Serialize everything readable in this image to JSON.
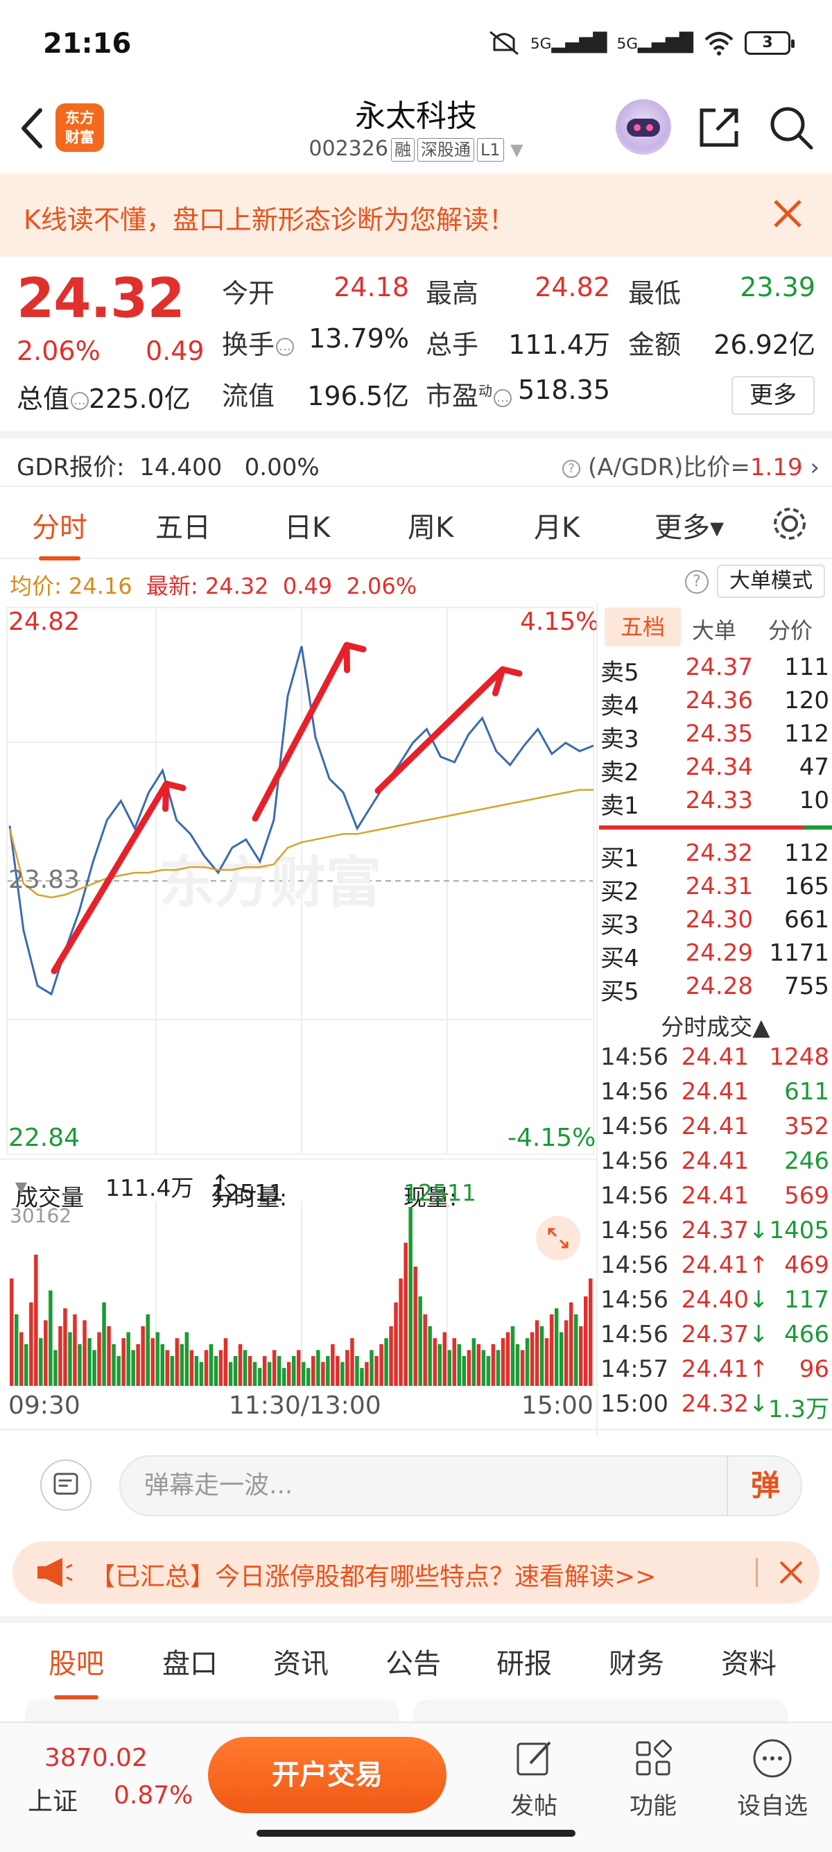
{
  "status_bar": {
    "time": "21:16",
    "net1": "5G",
    "net2": "5G",
    "battery": "3"
  },
  "nav": {
    "title": "永太科技",
    "code": "002326",
    "tags": [
      "融",
      "深股通",
      "L1"
    ],
    "logo_text_1": "东方",
    "logo_text_2": "财富"
  },
  "tip_banner": {
    "text": "K线读不懂，盘口上新形态诊断为您解读！"
  },
  "quote": {
    "price": "24.32",
    "change_pct": "2.06%",
    "change_amt": "0.49",
    "market_cap_label": "总值",
    "market_cap": "225.0亿",
    "open_label": "今开",
    "open": "24.18",
    "high_label": "最高",
    "high": "24.82",
    "low_label": "最低",
    "low": "23.39",
    "turnover_label": "换手",
    "turnover": "13.79%",
    "volume_label": "总手",
    "volume": "111.4万",
    "amount_label": "金额",
    "amount": "26.92亿",
    "float_label": "流值",
    "float_cap": "196.5亿",
    "pe_label": "市盈",
    "pe_sup": "动",
    "pe": "518.35",
    "more_label": "更多"
  },
  "gdr": {
    "label": "GDR报价:",
    "price": "14.400",
    "pct": "0.00%",
    "ratio_label": "(A/GDR)比价=",
    "ratio": "1.19"
  },
  "tabs": [
    "分时",
    "五日",
    "日K",
    "周K",
    "月K",
    "更多▾"
  ],
  "avg_line": {
    "avg_label": "均价:",
    "avg": "24.16",
    "latest_label": "最新:",
    "latest": "24.32",
    "chg": "0.49",
    "pct": "2.06%",
    "big_mode": "大单模式"
  },
  "chart_data": {
    "type": "line",
    "y_top": "24.82",
    "y_mid": "23.83",
    "y_bottom": "22.84",
    "pct_top": "4.15%",
    "pct_bottom": "-4.15%",
    "ylim": [
      22.84,
      24.82
    ],
    "x_labels": [
      "09:30",
      "11:30/13:00",
      "15:00"
    ],
    "series": [
      {
        "values": [
          24.03,
          23.65,
          23.45,
          23.42,
          23.58,
          23.72,
          23.9,
          24.05,
          24.12,
          24.02,
          24.15,
          24.23,
          24.05,
          24.0,
          23.92,
          23.86,
          23.95,
          23.98,
          23.9,
          24.05,
          24.5,
          24.68,
          24.35,
          24.2,
          24.15,
          24.02,
          24.1,
          24.18,
          24.25,
          24.33,
          24.38,
          24.28,
          24.26,
          24.36,
          24.42,
          24.3,
          24.25,
          24.32,
          24.38,
          24.29,
          24.33,
          24.3,
          24.32
        ]
      },
      {
        "values": [
          24.02,
          23.82,
          23.78,
          23.77,
          23.78,
          23.8,
          23.82,
          23.84,
          23.85,
          23.86,
          23.86,
          23.87,
          23.87,
          23.88,
          23.88,
          23.87,
          23.87,
          23.88,
          23.88,
          23.89,
          23.95,
          23.97,
          23.98,
          23.99,
          24.0,
          24.0,
          24.01,
          24.02,
          24.03,
          24.04,
          24.05,
          24.06,
          24.07,
          24.08,
          24.09,
          24.1,
          24.11,
          24.12,
          24.13,
          24.14,
          24.15,
          24.16,
          24.16
        ]
      }
    ],
    "volume": {
      "label": "成交量",
      "total": "111.4万",
      "fs_label": "分时量:",
      "fs_val": "12511",
      "now_label": "现量:",
      "now_val": "12511",
      "max": "30162",
      "values": [
        18,
        12,
        9,
        7,
        14,
        22,
        8,
        11,
        16,
        6,
        10,
        13,
        9,
        12,
        7,
        11,
        8,
        6,
        9,
        14,
        10,
        7,
        5,
        8,
        9,
        6,
        7,
        10,
        12,
        8,
        9,
        7,
        6,
        5,
        8,
        7,
        9,
        6,
        5,
        4,
        6,
        7,
        5,
        6,
        8,
        4,
        5,
        7,
        6,
        5,
        4,
        3,
        5,
        4,
        6,
        5,
        3,
        4,
        5,
        6,
        4,
        3,
        5,
        6,
        4,
        5,
        7,
        5,
        4,
        6,
        8,
        5,
        3,
        4,
        6,
        5,
        7,
        8,
        10,
        14,
        18,
        24,
        30,
        20,
        15,
        12,
        10,
        8,
        7,
        9,
        6,
        8,
        7,
        5,
        6,
        8,
        7,
        6,
        5,
        7,
        6,
        8,
        9,
        10,
        7,
        6,
        8,
        9,
        11,
        10,
        8,
        12,
        13,
        9,
        11,
        14,
        12,
        10,
        15,
        18
      ],
      "colors": [
        "r",
        "g",
        "r",
        "g",
        "r",
        "r",
        "g",
        "r",
        "g",
        "g",
        "r",
        "r",
        "g",
        "r",
        "g",
        "r",
        "g",
        "g",
        "r",
        "g",
        "r",
        "g",
        "g",
        "r",
        "g",
        "g",
        "r",
        "r",
        "g",
        "r",
        "g",
        "g",
        "r",
        "g",
        "r",
        "g",
        "g",
        "r",
        "g",
        "g",
        "r",
        "g",
        "g",
        "r",
        "r",
        "g",
        "g",
        "r",
        "g",
        "r",
        "g",
        "g",
        "r",
        "g",
        "r",
        "g",
        "g",
        "r",
        "g",
        "r",
        "g",
        "g",
        "r",
        "g",
        "r",
        "g",
        "r",
        "r",
        "g",
        "r",
        "r",
        "g",
        "g",
        "r",
        "g",
        "r",
        "r",
        "g",
        "r",
        "r",
        "r",
        "r",
        "g",
        "r",
        "g",
        "r",
        "g",
        "r",
        "g",
        "r",
        "g",
        "r",
        "g",
        "g",
        "r",
        "g",
        "r",
        "g",
        "g",
        "r",
        "g",
        "r",
        "r",
        "g",
        "g",
        "r",
        "g",
        "r",
        "r",
        "g",
        "r",
        "r",
        "g",
        "g",
        "r",
        "r",
        "g",
        "r",
        "r",
        "r"
      ]
    }
  },
  "order_book": {
    "tabs": [
      "五档",
      "大单",
      "分价"
    ],
    "asks": [
      {
        "label": "卖5",
        "price": "24.37",
        "vol": "111"
      },
      {
        "label": "卖4",
        "price": "24.36",
        "vol": "120"
      },
      {
        "label": "卖3",
        "price": "24.35",
        "vol": "112"
      },
      {
        "label": "卖2",
        "price": "24.34",
        "vol": "47"
      },
      {
        "label": "卖1",
        "price": "24.33",
        "vol": "10"
      }
    ],
    "bids": [
      {
        "label": "买1",
        "price": "24.32",
        "vol": "112"
      },
      {
        "label": "买2",
        "price": "24.31",
        "vol": "165"
      },
      {
        "label": "买3",
        "price": "24.30",
        "vol": "661"
      },
      {
        "label": "买4",
        "price": "24.29",
        "vol": "1171"
      },
      {
        "label": "买5",
        "price": "24.28",
        "vol": "755"
      }
    ],
    "trades_title": "分时成交▲",
    "trades": [
      {
        "time": "14:56",
        "price": "24.41",
        "vol": "1248",
        "dir": "",
        "color": "r"
      },
      {
        "time": "14:56",
        "price": "24.41",
        "vol": "611",
        "dir": "",
        "color": "g"
      },
      {
        "time": "14:56",
        "price": "24.41",
        "vol": "352",
        "dir": "",
        "color": "r"
      },
      {
        "time": "14:56",
        "price": "24.41",
        "vol": "246",
        "dir": "",
        "color": "g"
      },
      {
        "time": "14:56",
        "price": "24.41",
        "vol": "569",
        "dir": "",
        "color": "r"
      },
      {
        "time": "14:56",
        "price": "24.37",
        "vol": "1405",
        "dir": "↓",
        "color": "g"
      },
      {
        "time": "14:56",
        "price": "24.41",
        "vol": "469",
        "dir": "↑",
        "color": "r"
      },
      {
        "time": "14:56",
        "price": "24.40",
        "vol": "117",
        "dir": "↓",
        "color": "g"
      },
      {
        "time": "14:56",
        "price": "24.37",
        "vol": "466",
        "dir": "↓",
        "color": "g"
      },
      {
        "time": "14:57",
        "price": "24.41",
        "vol": "96",
        "dir": "↑",
        "color": "r"
      },
      {
        "time": "15:00",
        "price": "24.32",
        "vol": "1.3万",
        "dir": "↓",
        "color": "g"
      }
    ]
  },
  "watermark": "东方财富",
  "danmu": {
    "placeholder": "弹幕走一波...",
    "btn": "弹"
  },
  "notice": {
    "text": "【已汇总】今日涨停股都有哪些特点？速看解读>>"
  },
  "bottom_tabs": [
    "股吧",
    "盘口",
    "资讯",
    "公告",
    "研报",
    "财务",
    "资料"
  ],
  "footer": {
    "index_value": "3870.02",
    "index_name": "上证",
    "index_chg": "0.87%",
    "open_btn": "开户交易",
    "post": "发帖",
    "func": "功能",
    "watch": "设自选"
  },
  "colors": {
    "accent": "#e8531d",
    "up": "#e0302c",
    "down": "#1a9b35",
    "price_line": "#3a6bb0",
    "avg_line": "#d9a32a"
  }
}
